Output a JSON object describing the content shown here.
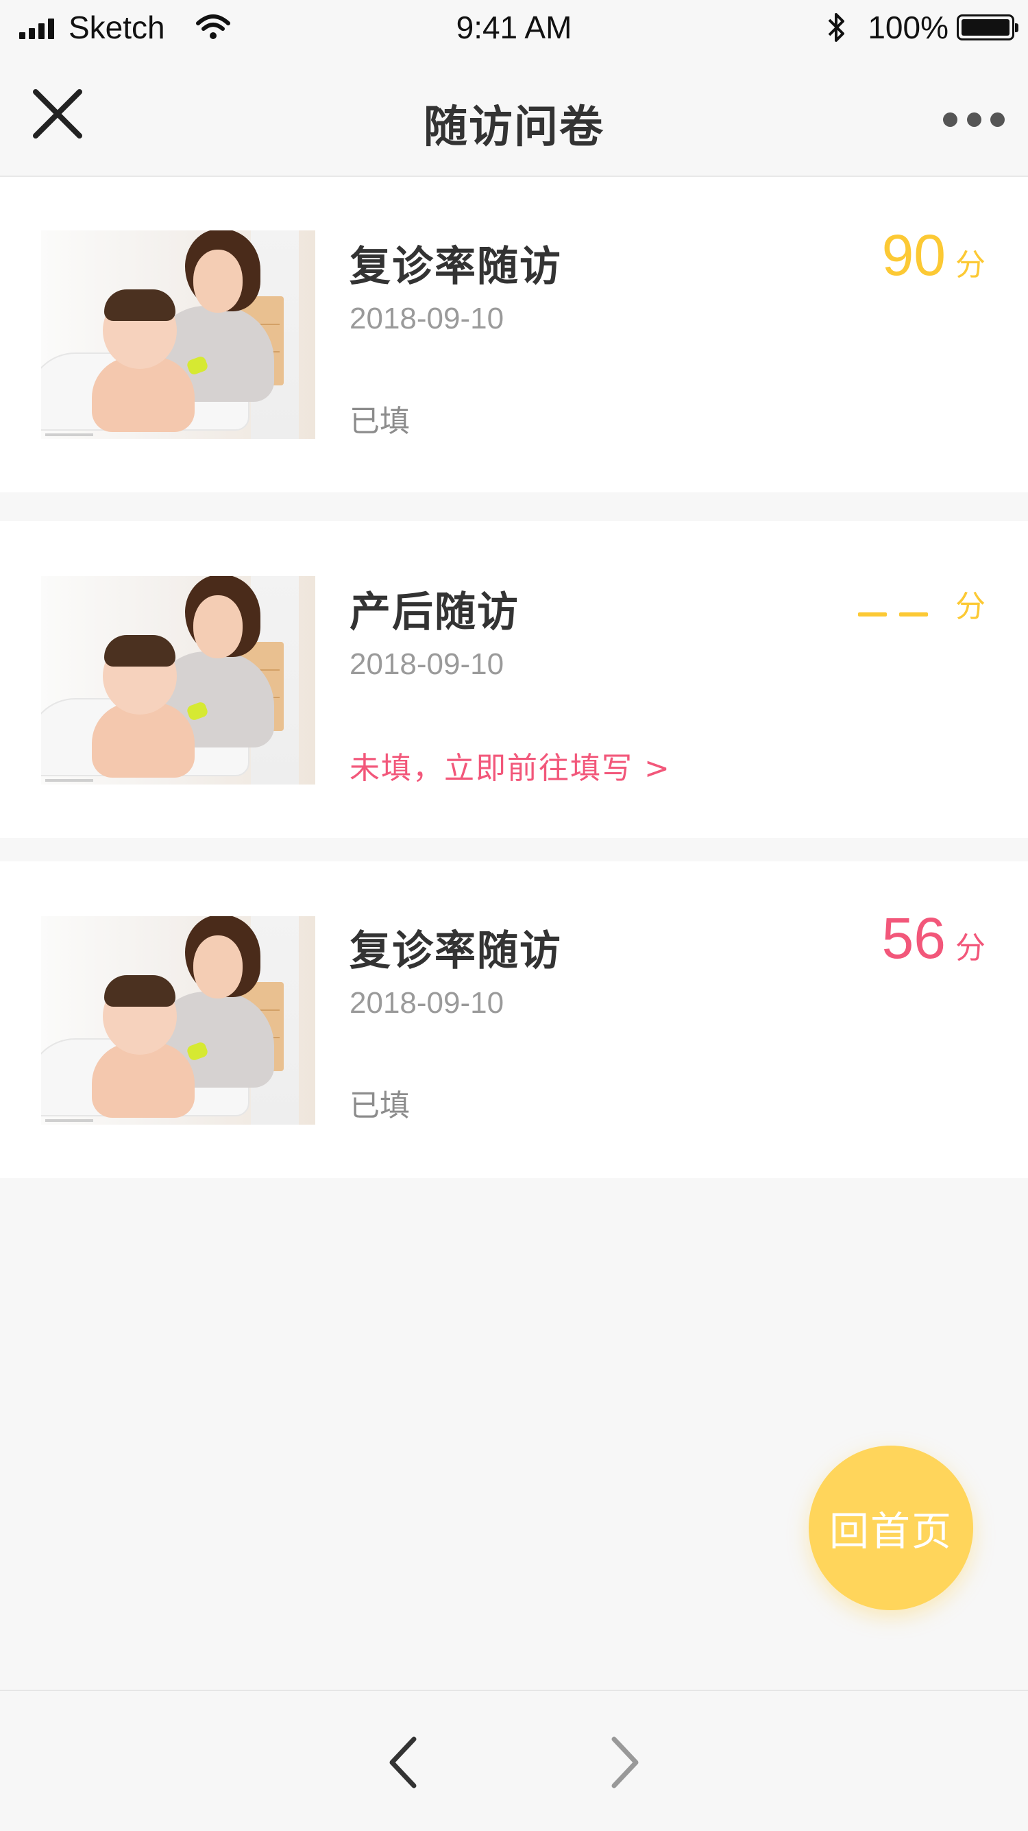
{
  "status_bar": {
    "carrier": "Sketch",
    "time": "9:41 AM",
    "battery": "100%",
    "icons": [
      "signal-icon",
      "wifi-icon",
      "bluetooth-icon",
      "battery-icon"
    ]
  },
  "nav_bar": {
    "title": "随访问卷",
    "close_icon": "close-icon",
    "more_icon": "more-icon"
  },
  "list": {
    "items": [
      {
        "title": "复诊率随访",
        "date": "2018-09-10",
        "status": "已填",
        "score": "90",
        "score_unit": "分",
        "score_color": "#fcc934"
      },
      {
        "title": "产后随访",
        "date": "2018-09-10",
        "status": "未填，立即前往填写 >",
        "score": "",
        "score_unit": "分",
        "score_color": "#fcc934",
        "status_color": "#f2577a"
      },
      {
        "title": "复诊率随访",
        "date": "2018-09-10",
        "status": "已填",
        "score": "56",
        "score_unit": "分",
        "score_color": "#f2577a"
      }
    ]
  },
  "fab": {
    "label": "回首页",
    "color": "#ffd55b"
  },
  "bottom_bar": {
    "back_icon": "chevron-left-icon",
    "forward_icon": "chevron-right-icon"
  }
}
